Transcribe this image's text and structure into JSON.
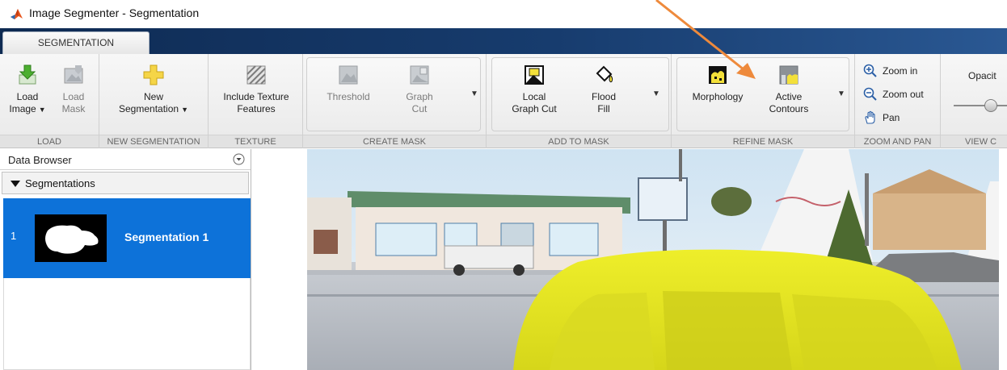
{
  "window": {
    "title": "Image Segmenter - Segmentation",
    "app_icon": "matlab-logo-icon"
  },
  "tabs": [
    {
      "label": "SEGMENTATION",
      "active": true
    }
  ],
  "ribbon": {
    "sections": {
      "load": "LOAD",
      "new_segmentation": "NEW SEGMENTATION",
      "texture": "TEXTURE",
      "create_mask": "CREATE MASK",
      "add_to_mask": "ADD TO MASK",
      "refine_mask": "REFINE MASK",
      "zoom_and_pan": "ZOOM AND PAN",
      "view": "VIEW C"
    },
    "buttons": {
      "load_image": {
        "line1": "Load",
        "line2": "Image",
        "icon": "load-image-icon"
      },
      "load_mask": {
        "line1": "Load",
        "line2": "Mask",
        "icon": "load-mask-icon"
      },
      "new_segmentation": {
        "line1": "New",
        "line2": "Segmentation",
        "icon": "plus-icon"
      },
      "include_texture": {
        "line1": "Include Texture",
        "line2": "Features",
        "icon": "texture-icon"
      },
      "threshold": {
        "line1": "Threshold",
        "icon": "threshold-icon"
      },
      "graph_cut": {
        "line1": "Graph",
        "line2": "Cut",
        "icon": "graph-cut-icon"
      },
      "local_graph_cut": {
        "line1": "Local",
        "line2": "Graph Cut",
        "icon": "local-graph-cut-icon"
      },
      "flood_fill": {
        "line1": "Flood",
        "line2": "Fill",
        "icon": "paint-bucket-icon"
      },
      "morphology": {
        "line1": "Morphology",
        "icon": "morphology-icon"
      },
      "active_contours": {
        "line1": "Active",
        "line2": "Contours",
        "icon": "active-contours-icon"
      },
      "zoom_in": {
        "label": "Zoom in",
        "icon": "zoom-in-icon"
      },
      "zoom_out": {
        "label": "Zoom out",
        "icon": "zoom-out-icon"
      },
      "pan": {
        "label": "Pan",
        "icon": "hand-icon"
      },
      "opacity": {
        "label": "Opacit"
      }
    }
  },
  "data_browser": {
    "title": "Data Browser",
    "group_label": "Segmentations",
    "items": [
      {
        "index": "1",
        "name": "Segmentation 1",
        "selected": true
      }
    ]
  },
  "colors": {
    "selection": "#0d72d9",
    "annotation_arrow": "#ee8a3c",
    "overlay": "#e6e619"
  }
}
